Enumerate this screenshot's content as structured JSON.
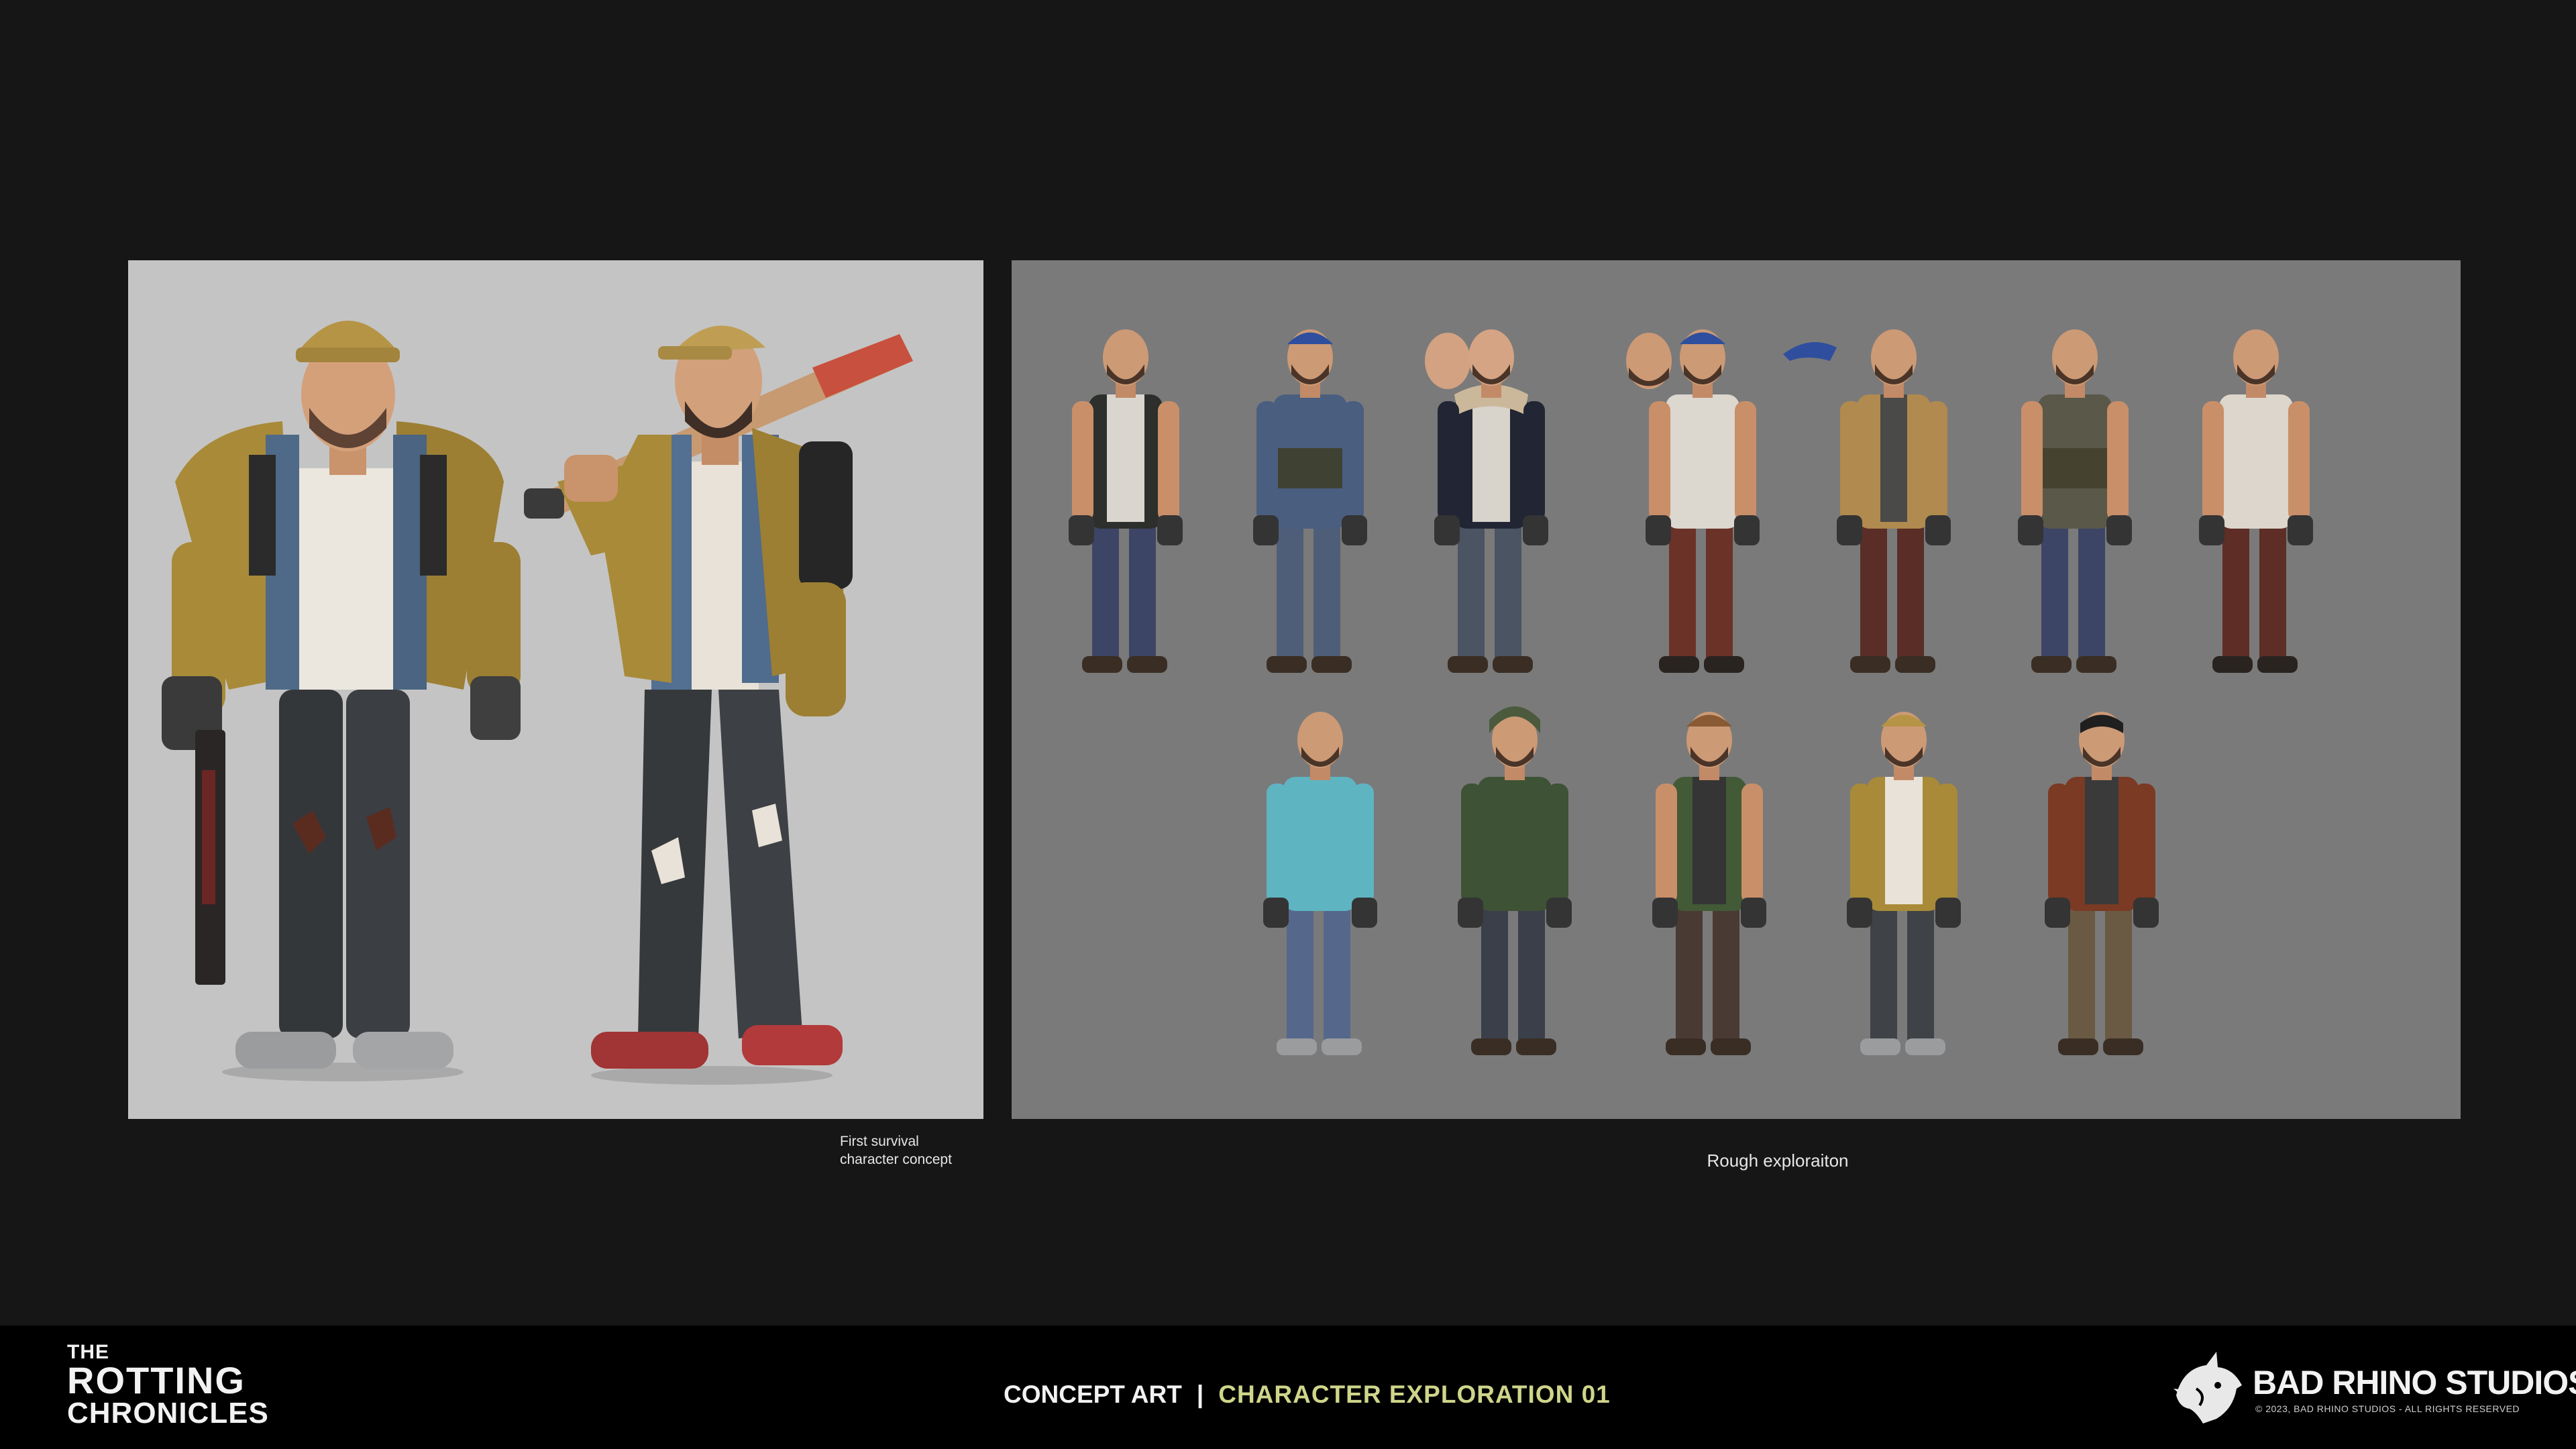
{
  "captions": {
    "left_line1": "First survival",
    "left_line2": "character concept",
    "right": "Rough exploraiton"
  },
  "footer": {
    "section": "CONCEPT ART",
    "separator": "|",
    "subtitle": "CHARACTER EXPLORATION 01"
  },
  "game_logo": {
    "line1": "THE",
    "line2": "ROTTING",
    "line3": "CHRONICLES"
  },
  "studio": {
    "name": "BAD RHINO STUDIOS",
    "copyright": "© 2023, BAD RHINO STUDIOS - ALL RIGHTS RESERVED",
    "icon": "rhino-icon"
  },
  "colors": {
    "background": "#161616",
    "left_panel": "#c4c4c4",
    "right_panel": "#7a7a7a",
    "footer_accent": "#cfd58a"
  }
}
